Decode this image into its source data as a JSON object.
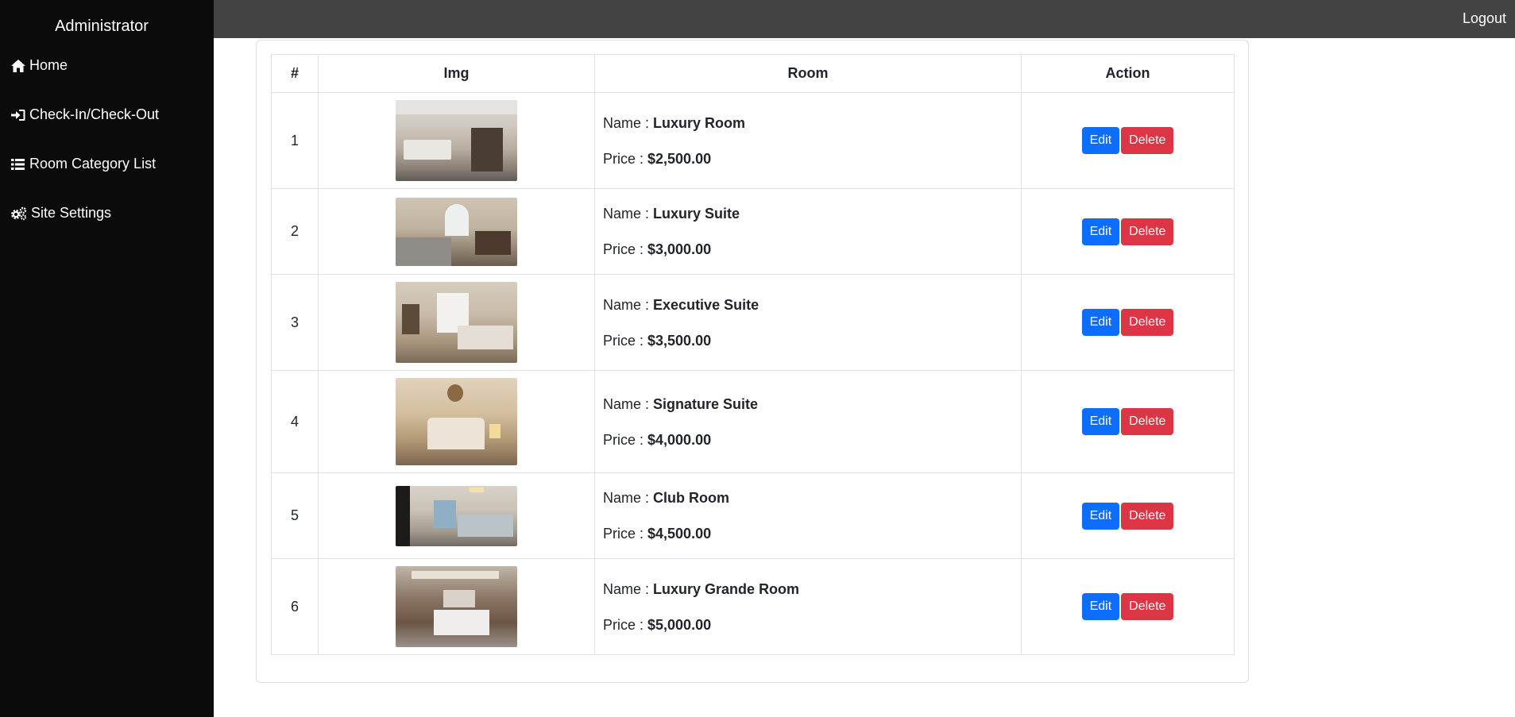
{
  "sidebar": {
    "brand": "Administrator",
    "items": [
      {
        "label": "Home",
        "icon": "home-icon"
      },
      {
        "label": "Check-In/Check-Out",
        "icon": "sign-in-icon"
      },
      {
        "label": "Room Category List",
        "icon": "list-icon"
      },
      {
        "label": "Site Settings",
        "icon": "gears-icon"
      }
    ]
  },
  "topbar": {
    "logout": "Logout"
  },
  "table": {
    "headers": [
      "#",
      "Img",
      "Room",
      "Action"
    ],
    "name_prefix": "Name : ",
    "price_prefix": "Price : ",
    "edit_label": "Edit",
    "delete_label": "Delete",
    "rows": [
      {
        "num": "1",
        "name": "Luxury Room",
        "price": "$2,500.00"
      },
      {
        "num": "2",
        "name": "Luxury Suite",
        "price": "$3,000.00"
      },
      {
        "num": "3",
        "name": "Executive Suite",
        "price": "$3,500.00"
      },
      {
        "num": "4",
        "name": "Signature Suite",
        "price": "$4,000.00"
      },
      {
        "num": "5",
        "name": "Club Room",
        "price": "$4,500.00"
      },
      {
        "num": "6",
        "name": "Luxury Grande Room",
        "price": "$5,000.00"
      }
    ]
  },
  "colors": {
    "sidebar_bg": "#0b0b0b",
    "topbar_bg": "#434343",
    "edit_button": "#0d6efd",
    "delete_button": "#dc3545"
  }
}
